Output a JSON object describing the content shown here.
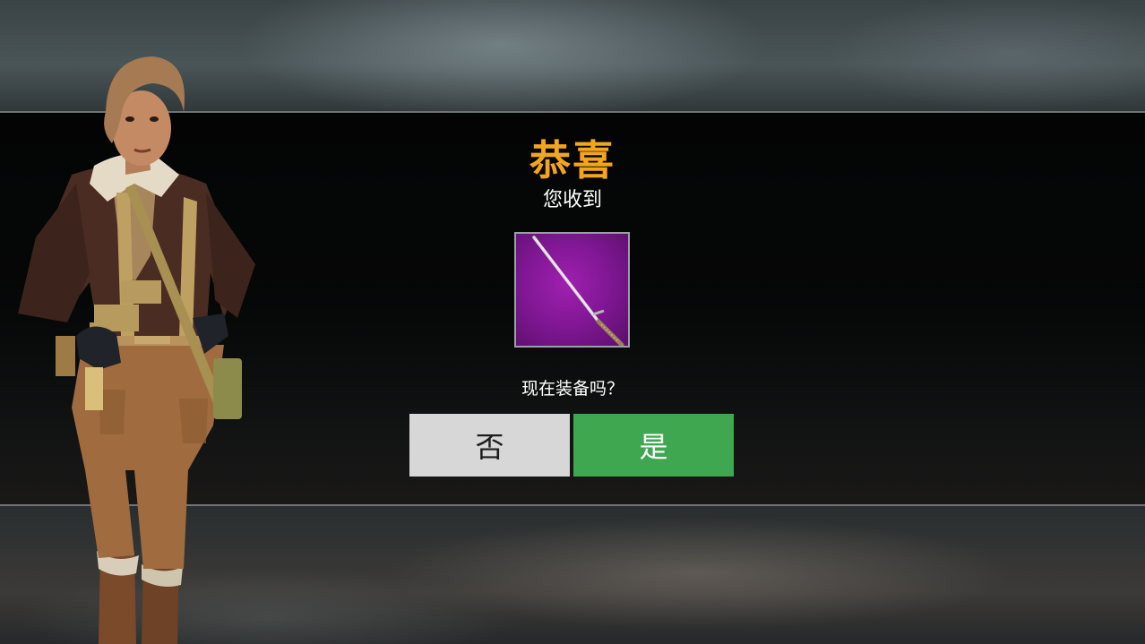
{
  "dialog": {
    "title": "恭喜",
    "subtitle": "您收到",
    "question": "现在装备吗？",
    "no_label": "否",
    "yes_label": "是"
  },
  "item": {
    "icon": "sword-icon",
    "rarity_color": "#8e1aa3"
  },
  "colors": {
    "title": "#f2a51e",
    "yes_button": "#3ea750",
    "no_button": "#d7d7d7"
  }
}
